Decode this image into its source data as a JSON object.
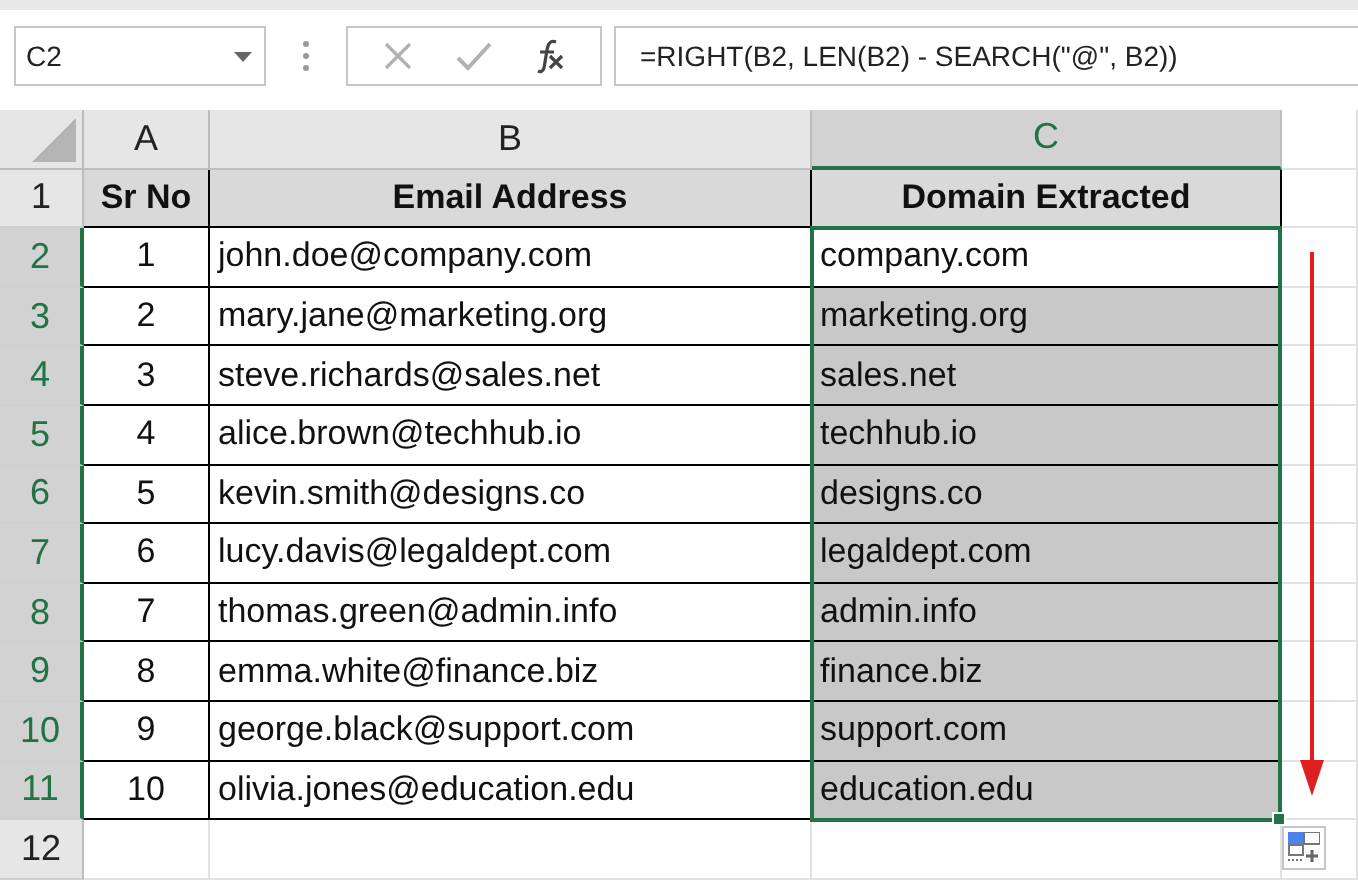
{
  "name_box": "C2",
  "formula_buttons": [
    {
      "kind": "cancel",
      "disabled": true
    },
    {
      "kind": "enter",
      "disabled": true
    },
    {
      "kind": "function",
      "disabled": false
    }
  ],
  "formula": "=RIGHT(B2, LEN(B2) - SEARCH(\"@\", B2))",
  "columns": [
    {
      "label": "A",
      "selected": false
    },
    {
      "label": "B",
      "selected": false
    },
    {
      "label": "C",
      "selected": true
    }
  ],
  "rows": [
    {
      "number": "1",
      "selected": false,
      "header": true,
      "cells": [
        "Sr No",
        "Email Address",
        "Domain Extracted"
      ]
    },
    {
      "number": "2",
      "selected": true,
      "active": true,
      "cells": [
        "1",
        "john.doe@company.com",
        "company.com"
      ]
    },
    {
      "number": "3",
      "selected": true,
      "active": false,
      "cells": [
        "2",
        "mary.jane@marketing.org",
        "marketing.org"
      ]
    },
    {
      "number": "4",
      "selected": true,
      "active": false,
      "cells": [
        "3",
        "steve.richards@sales.net",
        "sales.net"
      ]
    },
    {
      "number": "5",
      "selected": true,
      "active": false,
      "cells": [
        "4",
        "alice.brown@techhub.io",
        "techhub.io"
      ]
    },
    {
      "number": "6",
      "selected": true,
      "active": false,
      "cells": [
        "5",
        "kevin.smith@designs.co",
        "designs.co"
      ]
    },
    {
      "number": "7",
      "selected": true,
      "active": false,
      "cells": [
        "6",
        "lucy.davis@legaldept.com",
        "legaldept.com"
      ]
    },
    {
      "number": "8",
      "selected": true,
      "active": false,
      "cells": [
        "7",
        "thomas.green@admin.info",
        "admin.info"
      ]
    },
    {
      "number": "9",
      "selected": true,
      "active": false,
      "cells": [
        "8",
        "emma.white@finance.biz",
        "finance.biz"
      ]
    },
    {
      "number": "10",
      "selected": true,
      "active": false,
      "cells": [
        "9",
        "george.black@support.com",
        "support.com"
      ]
    },
    {
      "number": "11",
      "selected": true,
      "active": false,
      "cells": [
        "10",
        "olivia.jones@education.edu",
        "education.edu"
      ]
    },
    {
      "number": "12",
      "selected": false
    }
  ]
}
